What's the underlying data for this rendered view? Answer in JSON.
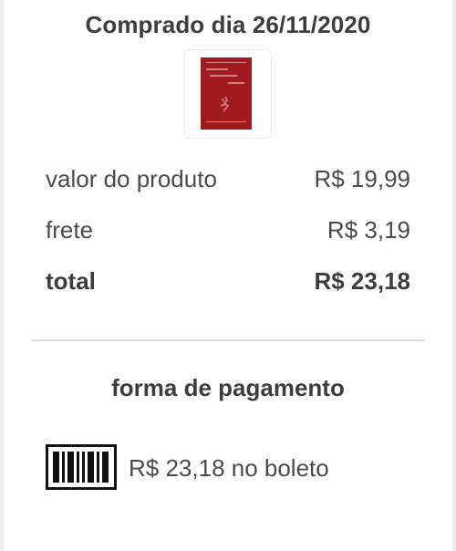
{
  "order": {
    "purchased_label": "Comprado dia 26/11/2020",
    "product_image_icon": "book-cover-thumbnail"
  },
  "summary": {
    "product_label": "valor do produto",
    "product_value": "R$ 19,99",
    "shipping_label": "frete",
    "shipping_value": "R$ 3,19",
    "total_label": "total",
    "total_value": "R$ 23,18"
  },
  "payment": {
    "heading": "forma de pagamento",
    "method_icon": "barcode-icon",
    "method_text": "R$ 23,18 no boleto"
  },
  "colors": {
    "text_primary": "#3d3d3d",
    "text_secondary": "#4a4a4a",
    "book_cover": "#a11a1e",
    "divider": "#dcdcdc"
  }
}
